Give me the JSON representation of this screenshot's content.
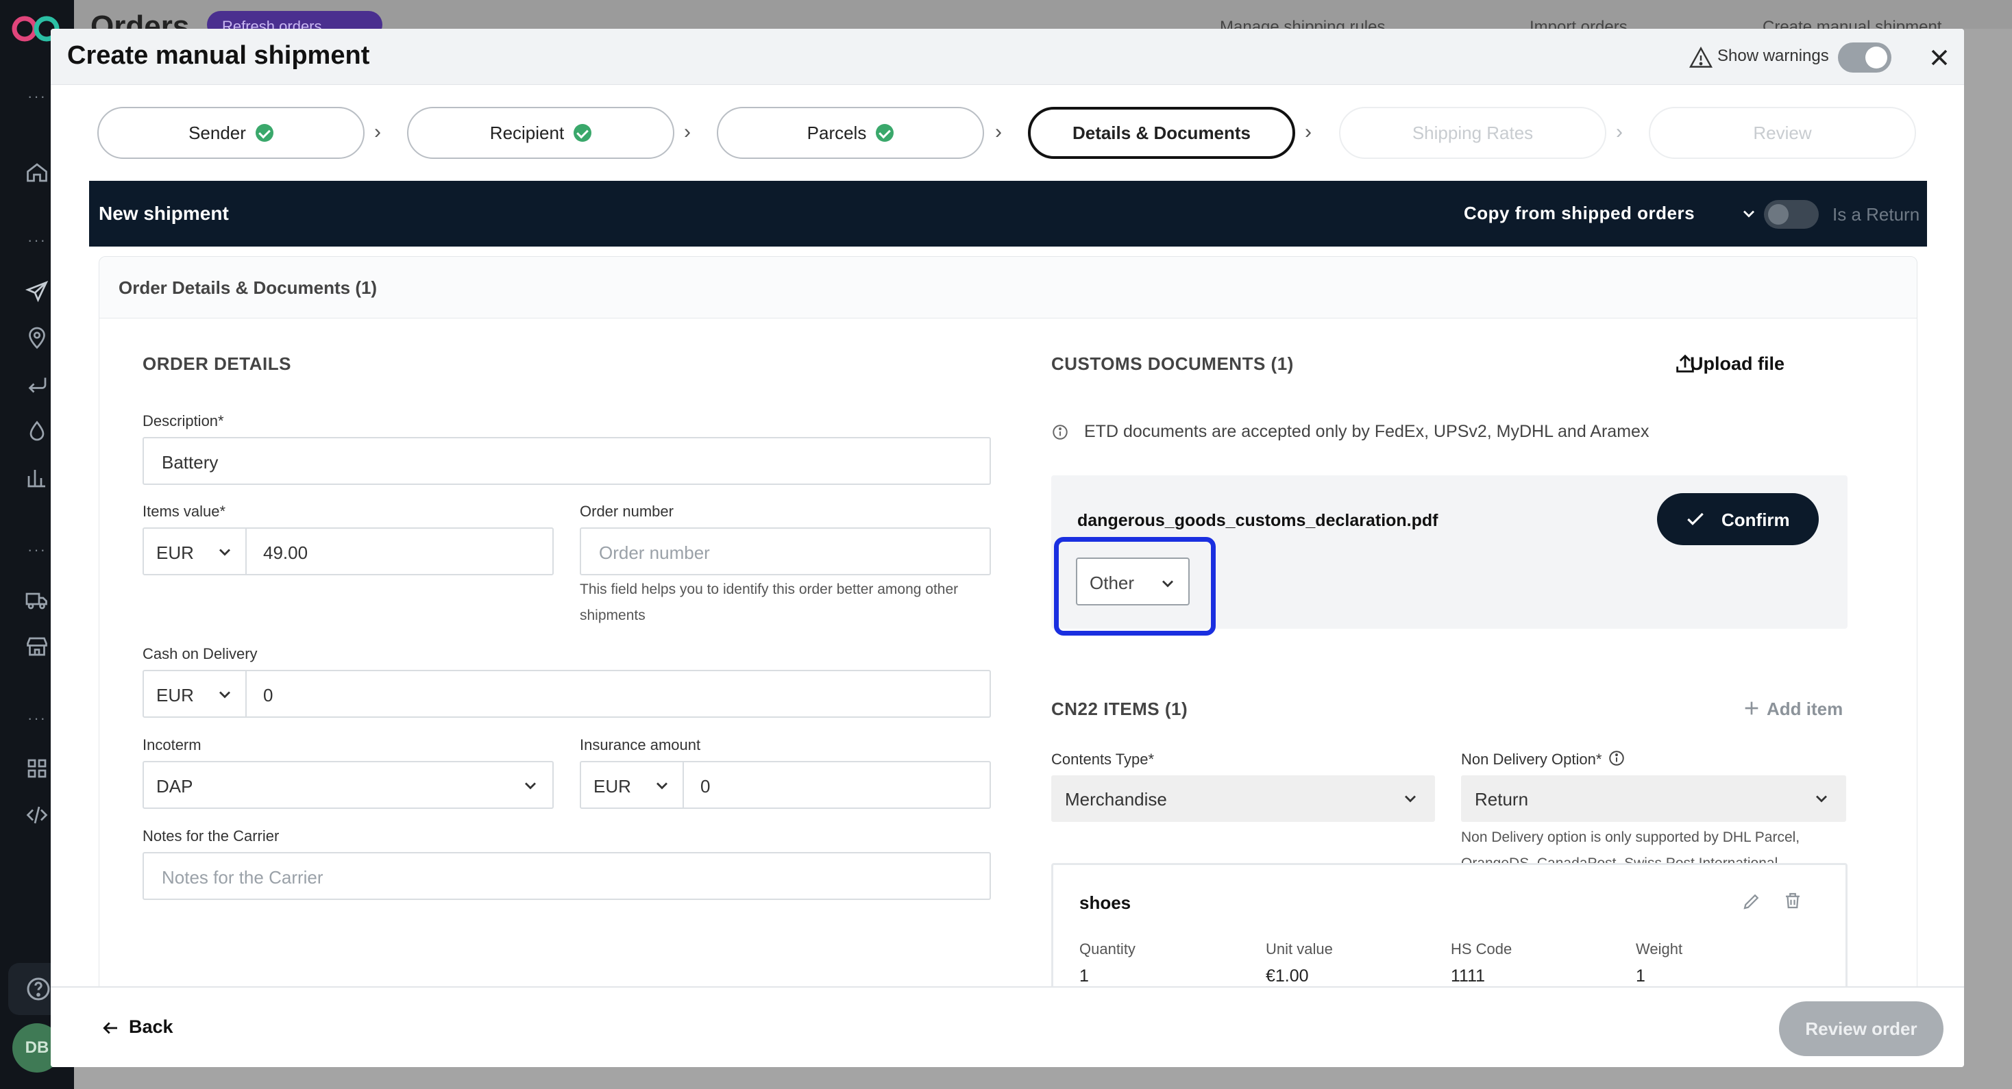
{
  "background": {
    "page_title": "Orders",
    "refresh_label": "Refresh orders",
    "actions": [
      "Manage shipping rules",
      "Import orders",
      "Create manual shipment"
    ],
    "avatar_initials": "DB"
  },
  "modal": {
    "title": "Create manual shipment",
    "show_warnings_label": "Show warnings",
    "show_warnings_on": true
  },
  "steps": [
    {
      "label": "Sender",
      "state": "done"
    },
    {
      "label": "Recipient",
      "state": "done"
    },
    {
      "label": "Parcels",
      "state": "done"
    },
    {
      "label": "Details & Documents",
      "state": "active"
    },
    {
      "label": "Shipping Rates",
      "state": "disabled"
    },
    {
      "label": "Review",
      "state": "disabled"
    }
  ],
  "shipment_bar": {
    "title": "New shipment",
    "copy_label": "Copy from shipped orders",
    "return_label": "Is a Return",
    "is_return": false
  },
  "panel": {
    "title": "Order Details & Documents (1)"
  },
  "order_details": {
    "section_title": "ORDER DETAILS",
    "description_label": "Description",
    "description_value": "Battery",
    "items_value_label": "Items value",
    "items_value_currency": "EUR",
    "items_value_amount": "49.00",
    "order_number_label": "Order number",
    "order_number_placeholder": "Order number",
    "order_number_hint": "This field helps you to identify this order better among other shipments",
    "cod_label": "Cash on Delivery",
    "cod_currency": "EUR",
    "cod_amount": "0",
    "incoterm_label": "Incoterm",
    "incoterm_value": "DAP",
    "insurance_label": "Insurance amount",
    "insurance_currency": "EUR",
    "insurance_amount": "0",
    "notes_label": "Notes for the Carrier",
    "notes_placeholder": "Notes for the Carrier"
  },
  "customs": {
    "section_title": "CUSTOMS DOCUMENTS (1)",
    "upload_label": "Upload file",
    "etd_note": "ETD documents are accepted only by FedEx, UPSv2, MyDHL and Aramex",
    "document": {
      "filename": "dangerous_goods_customs_declaration.pdf",
      "type_value": "Other",
      "confirm_label": "Confirm"
    }
  },
  "cn22": {
    "section_title": "CN22 ITEMS (1)",
    "add_item_label": "Add item",
    "contents_type_label": "Contents Type",
    "contents_type_value": "Merchandise",
    "non_delivery_label": "Non Delivery Option",
    "non_delivery_value": "Return",
    "non_delivery_hint": "Non Delivery option is only supported by DHL Parcel, OrangeDS, CanadaPost, Swiss Post International",
    "item": {
      "name": "shoes",
      "quantity_label": "Quantity",
      "quantity": "1",
      "unit_value_label": "Unit value",
      "unit_value": "€1.00",
      "hs_code_label": "HS Code",
      "hs_code": "1111",
      "weight_label": "Weight",
      "weight": "1"
    }
  },
  "footer": {
    "back_label": "Back",
    "review_label": "Review order"
  },
  "colors": {
    "dark_navy": "#0c1a2a",
    "success_green": "#3aa86b",
    "highlight_blue": "#1a2fe0",
    "disabled_gray": "#a9aeb3"
  }
}
